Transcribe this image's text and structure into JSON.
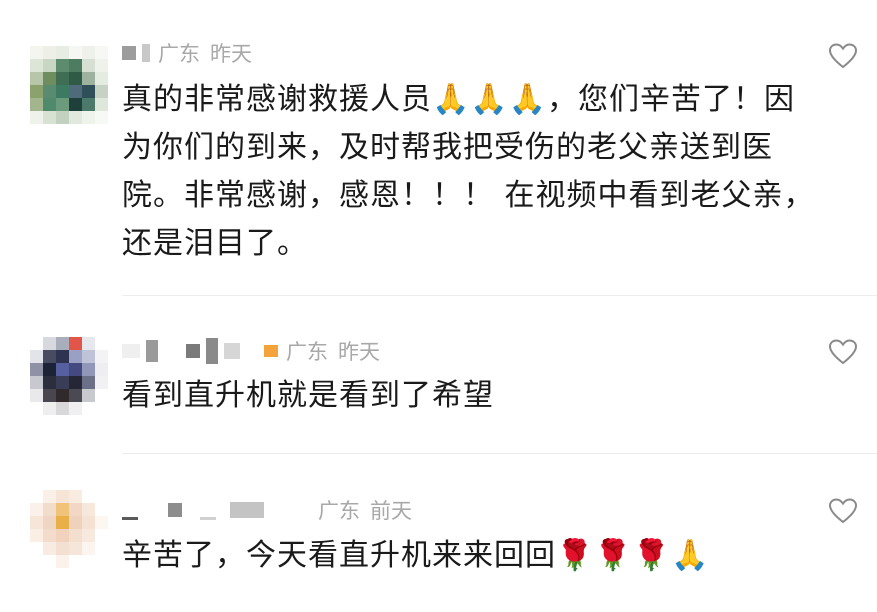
{
  "comments": [
    {
      "location": "广东",
      "time": "昨天",
      "lines": [
        "真的非常感谢救援人员🙏🙏🙏，您们辛苦了！因",
        "为你们的到来，及时帮我把受伤的老父亲送到医",
        "院。非常感谢，感恩！！！ 在视频中看到老父亲，",
        "还是泪目了。"
      ],
      "liked": false
    },
    {
      "location": "广东",
      "time": "昨天",
      "lines": [
        "看到直升机就是看到了希望"
      ],
      "liked": false
    },
    {
      "location": "广东",
      "time": "前天",
      "lines": [
        "辛苦了，今天看直升机来来回回🌹🌹🌹🙏"
      ],
      "liked": false
    }
  ],
  "icons": {
    "like": "heart-outline-icon"
  },
  "colors": {
    "meta_text": "#a8a8a8",
    "body_text": "#1a1a1a",
    "divider": "#ececec"
  }
}
